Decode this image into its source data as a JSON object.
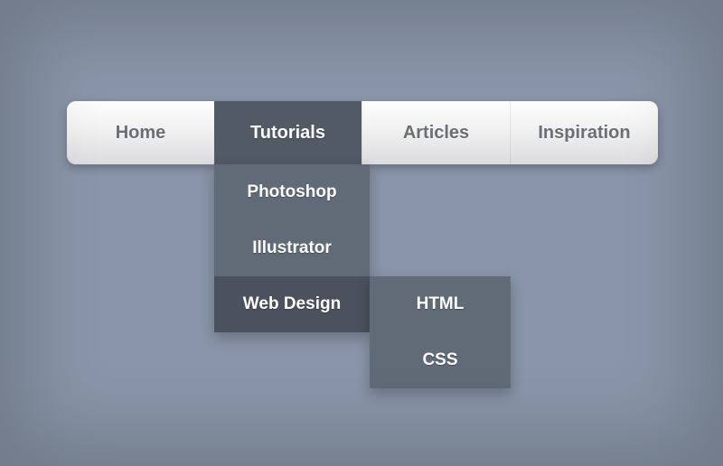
{
  "nav": {
    "items": [
      {
        "label": "Home"
      },
      {
        "label": "Tutorials"
      },
      {
        "label": "Articles"
      },
      {
        "label": "Inspiration"
      }
    ]
  },
  "dropdown": {
    "items": [
      {
        "label": "Photoshop"
      },
      {
        "label": "Illustrator"
      },
      {
        "label": "Web Design"
      }
    ]
  },
  "submenu": {
    "items": [
      {
        "label": "HTML"
      },
      {
        "label": "CSS"
      }
    ]
  }
}
